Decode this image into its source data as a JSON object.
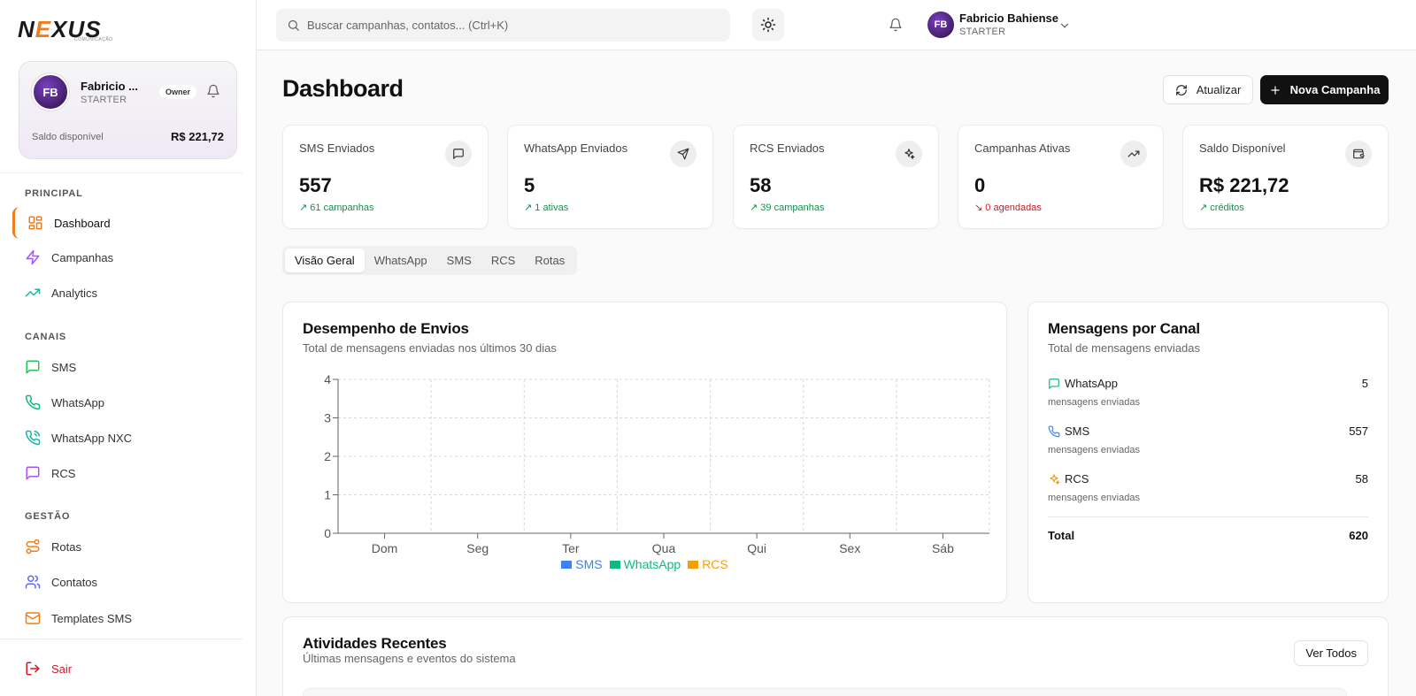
{
  "logo": {
    "text_n": "N",
    "text_e": "E",
    "text_rest": "XUS",
    "sub": "COMUNICAÇÃO"
  },
  "user_card": {
    "initials": "FB",
    "name": "Fabricio ...",
    "plan": "STARTER",
    "badge": "Owner",
    "balance_label": "Saldo disponível",
    "balance_value": "R$ 221,72"
  },
  "sidebar": {
    "sections": [
      {
        "title": "PRINCIPAL"
      },
      {
        "title": "CANAIS"
      },
      {
        "title": "GESTÃO"
      }
    ],
    "items": [
      {
        "label": "Dashboard",
        "icon": "grid-icon",
        "color": "#f07d1a",
        "active": true
      },
      {
        "label": "Campanhas",
        "icon": "zap-icon",
        "color": "#a855f7"
      },
      {
        "label": "Analytics",
        "icon": "trending-up-icon",
        "color": "#14b8a6"
      },
      {
        "label": "SMS",
        "icon": "message-square-icon",
        "color": "#22c55e"
      },
      {
        "label": "WhatsApp",
        "icon": "phone-icon",
        "color": "#10b981"
      },
      {
        "label": "WhatsApp NXC",
        "icon": "phone-call-icon",
        "color": "#14b8a6"
      },
      {
        "label": "RCS",
        "icon": "message-square-icon",
        "color": "#a855f7"
      },
      {
        "label": "Rotas",
        "icon": "route-icon",
        "color": "#f07d1a"
      },
      {
        "label": "Contatos",
        "icon": "users-icon",
        "color": "#6366f1"
      },
      {
        "label": "Templates SMS",
        "icon": "mail-icon",
        "color": "#f07d1a"
      }
    ],
    "logout": "Sair"
  },
  "topbar": {
    "search_placeholder": "Buscar campanhas, contatos... (Ctrl+K)",
    "user_initials": "FB",
    "user_name": "Fabricio Bahiense",
    "user_plan": "STARTER"
  },
  "page": {
    "title": "Dashboard",
    "refresh_label": "Atualizar",
    "new_campaign_label": "Nova Campanha"
  },
  "stats": [
    {
      "label": "SMS Enviados",
      "value": "557",
      "sub": "61 campanhas",
      "trend": "up",
      "icon": "message-square-icon"
    },
    {
      "label": "WhatsApp Enviados",
      "value": "5",
      "sub": "1 ativas",
      "trend": "up",
      "icon": "send-icon"
    },
    {
      "label": "RCS Enviados",
      "value": "58",
      "sub": "39 campanhas",
      "trend": "up",
      "icon": "sparkles-icon"
    },
    {
      "label": "Campanhas Ativas",
      "value": "0",
      "sub": "0 agendadas",
      "trend": "down",
      "icon": "trending-up-icon"
    },
    {
      "label": "Saldo Disponível",
      "value": "R$ 221,72",
      "sub": "créditos",
      "trend": "up",
      "icon": "wallet-icon"
    }
  ],
  "tabs": [
    "Visão Geral",
    "WhatsApp",
    "SMS",
    "RCS",
    "Rotas"
  ],
  "performance": {
    "title": "Desempenho de Envios",
    "subtitle": "Total de mensagens enviadas nos últimos 30 dias"
  },
  "chart_data": {
    "type": "bar",
    "categories": [
      "Dom",
      "Seg",
      "Ter",
      "Qua",
      "Qui",
      "Sex",
      "Sáb"
    ],
    "series": [
      {
        "name": "SMS",
        "color": "#3b82f6",
        "values": [
          0,
          0,
          0,
          0,
          0,
          0,
          0
        ]
      },
      {
        "name": "WhatsApp",
        "color": "#10b981",
        "values": [
          0,
          0,
          0,
          0,
          0,
          0,
          0
        ]
      },
      {
        "name": "RCS",
        "color": "#f59e0b",
        "values": [
          0,
          0,
          0,
          0,
          0,
          0,
          0
        ]
      }
    ],
    "yticks": [
      0,
      1,
      2,
      3,
      4
    ],
    "ylim": [
      0,
      4
    ],
    "grid": true,
    "legend": "bottom"
  },
  "channels": {
    "title": "Mensagens por Canal",
    "subtitle": "Total de mensagens enviadas",
    "rows": [
      {
        "name": "WhatsApp",
        "value": "5",
        "sub": "mensagens enviadas",
        "icon": "message-circle-icon",
        "color": "#10b981"
      },
      {
        "name": "SMS",
        "value": "557",
        "sub": "mensagens enviadas",
        "icon": "phone-icon",
        "color": "#3b82f6"
      },
      {
        "name": "RCS",
        "value": "58",
        "sub": "mensagens enviadas",
        "icon": "sparkles-icon",
        "color": "#f59e0b"
      }
    ],
    "total_label": "Total",
    "total_value": "620"
  },
  "activities": {
    "title": "Atividades Recentes",
    "subtitle": "Últimas mensagens e eventos do sistema",
    "view_all": "Ver Todos"
  }
}
